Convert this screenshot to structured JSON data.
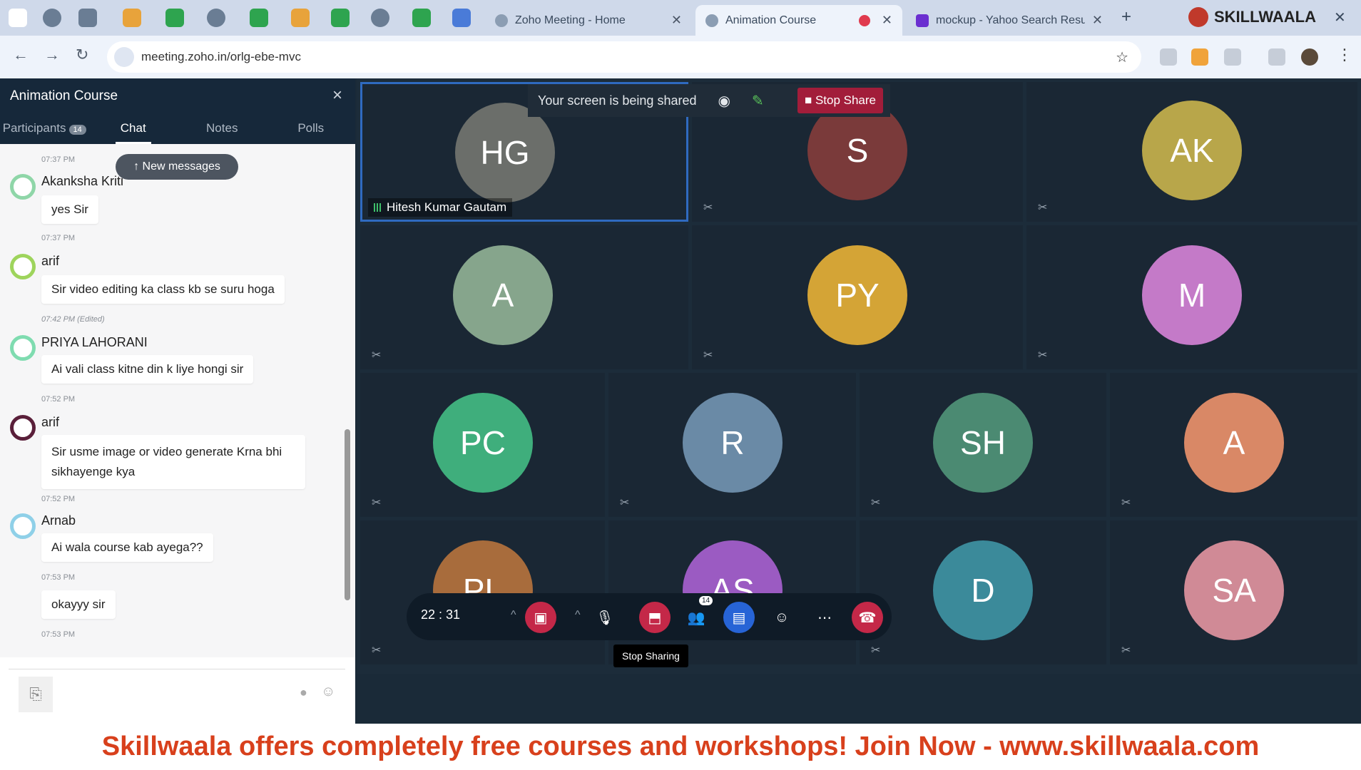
{
  "tabs": [
    {
      "title": "Zoho Meeting - Home",
      "active": false
    },
    {
      "title": "Animation Course",
      "active": true
    },
    {
      "title": "mockup - Yahoo Search Results",
      "active": false
    }
  ],
  "new_tab": "+",
  "logo_text": "SKILLWAALA",
  "url": "meeting.zoho.in/orlg-ebe-mvc",
  "sidebar": {
    "title": "Animation Course",
    "close": "×",
    "tabs": [
      {
        "label": "Participants",
        "badge": "14"
      },
      {
        "label": "Chat"
      },
      {
        "label": "Notes"
      },
      {
        "label": "Polls"
      }
    ],
    "new_messages": "↑  New messages",
    "messages": [
      {
        "time": "07:37 PM"
      },
      {
        "sender": "Akanksha Kriti",
        "text": "yes Sir",
        "time": "07:37 PM",
        "color": "#8fd6a8"
      },
      {
        "sender": "arif",
        "text": "Sir video editing ka class kb se suru hoga",
        "time": "07:42 PM (Edited)",
        "color": "#9ed45c"
      },
      {
        "sender": "PRIYA LAHORANI",
        "text": "Ai vali class kitne din k liye hongi sir",
        "time": "07:52 PM",
        "color": "#7fdcb0"
      },
      {
        "sender": "arif",
        "text": "Sir usme image or video generate Krna bhi sikhayenge kya",
        "time": "07:52 PM",
        "color": "#5a1f3a"
      },
      {
        "sender": "Arnab",
        "text": "Ai wala course kab ayega??",
        "time": "07:53 PM",
        "color": "#8fd0e8"
      },
      {
        "text": "okayyy sir",
        "time": "07:53 PM"
      }
    ]
  },
  "share_bar": {
    "text": "Your screen is being shared",
    "stop": "Stop Share"
  },
  "participants": [
    {
      "initials": "HG",
      "color": "#6b6e6a",
      "name": "Hitesh Kumar Gautam"
    },
    {
      "initials": "S",
      "color": "#7a3a3a"
    },
    {
      "initials": "AK",
      "color": "#b8a64a"
    },
    {
      "initials": "A",
      "color": "#86a58c"
    },
    {
      "initials": "PY",
      "color": "#d4a436"
    },
    {
      "initials": "M",
      "color": "#c47ac8"
    },
    {
      "initials": "PC",
      "color": "#3fae7c"
    },
    {
      "initials": "R",
      "color": "#6a8aa6"
    },
    {
      "initials": "SH",
      "color": "#4b8a72"
    },
    {
      "initials": "A",
      "color": "#d98866"
    },
    {
      "initials": "PL",
      "color": "#a86c3c"
    },
    {
      "initials": "AS",
      "color": "#9b5bc2"
    },
    {
      "initials": "D",
      "color": "#3b8a9a"
    },
    {
      "initials": "SA",
      "color": "#d08a96"
    }
  ],
  "controls": {
    "timer": "22 : 31",
    "participants_badge": "14",
    "tooltip": "Stop Sharing"
  },
  "banner": "Skillwaala offers completely free courses and workshops! Join Now  - www.skillwaala.com"
}
